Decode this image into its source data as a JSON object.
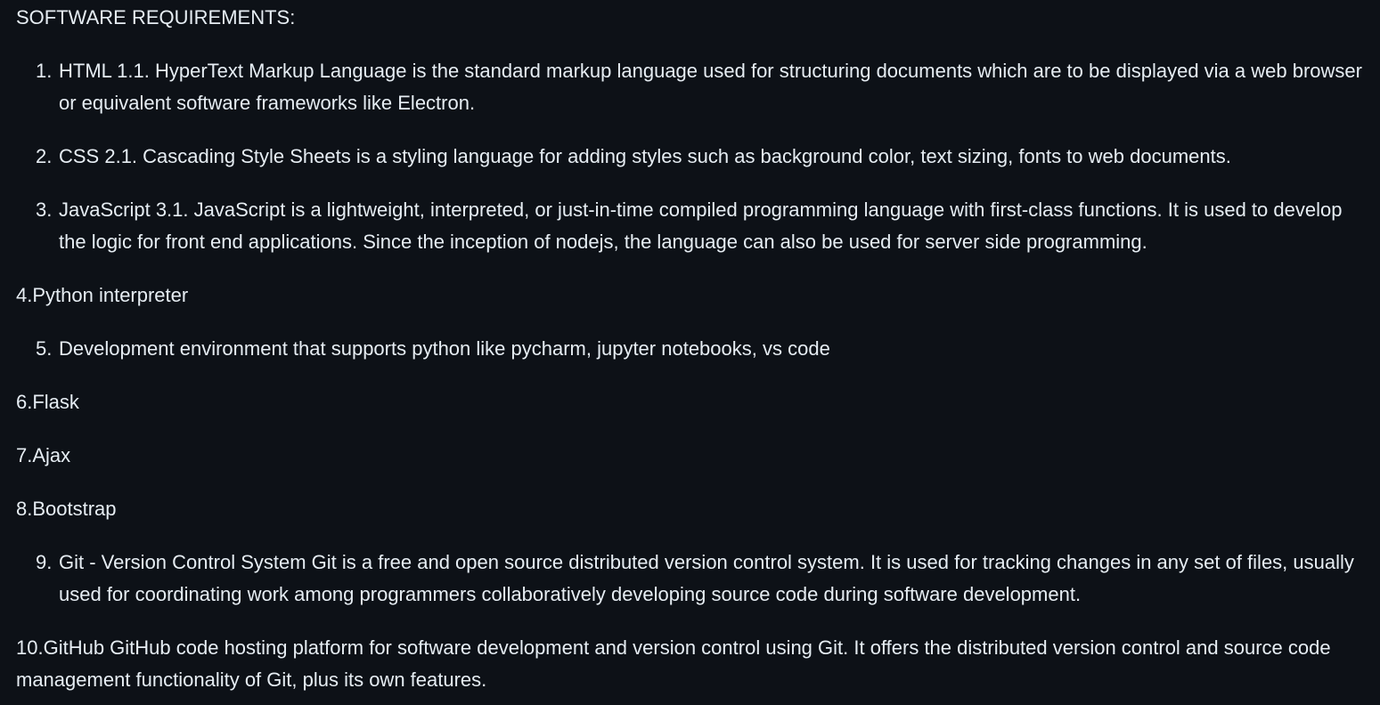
{
  "heading": "SOFTWARE REQUIREMENTS:",
  "items": [
    {
      "num": "1.",
      "text": "HTML 1.1. HyperText Markup Language is the standard markup language used for structuring documents which are to be displayed via a web browser or equivalent software frameworks like Electron."
    },
    {
      "num": "2.",
      "text": "CSS 2.1. Cascading Style Sheets is a styling language for adding styles such as background color, text sizing, fonts to web documents."
    },
    {
      "num": "3.",
      "text": "JavaScript 3.1. JavaScript is a lightweight, interpreted, or just-in-time compiled programming language with first-class functions. It is used to develop the logic for front end applications. Since the inception of nodejs, the language can also be used for server side programming."
    },
    {
      "text": "4.Python interpreter"
    },
    {
      "num": "5.",
      "text": "Development environment that supports python like pycharm, jupyter notebooks, vs code"
    },
    {
      "text": "6.Flask"
    },
    {
      "text": "7.Ajax"
    },
    {
      "text": "8.Bootstrap"
    },
    {
      "num": "9.",
      "text": "Git - Version Control System Git is a free and open source distributed version control system. It is used for tracking changes in any set of files, usually used for coordinating work among programmers collaboratively developing source code during software development."
    },
    {
      "text": "10.GitHub GitHub code hosting platform for software development and version control using Git. It offers the distributed version control and source code management functionality of Git, plus its own features."
    }
  ]
}
